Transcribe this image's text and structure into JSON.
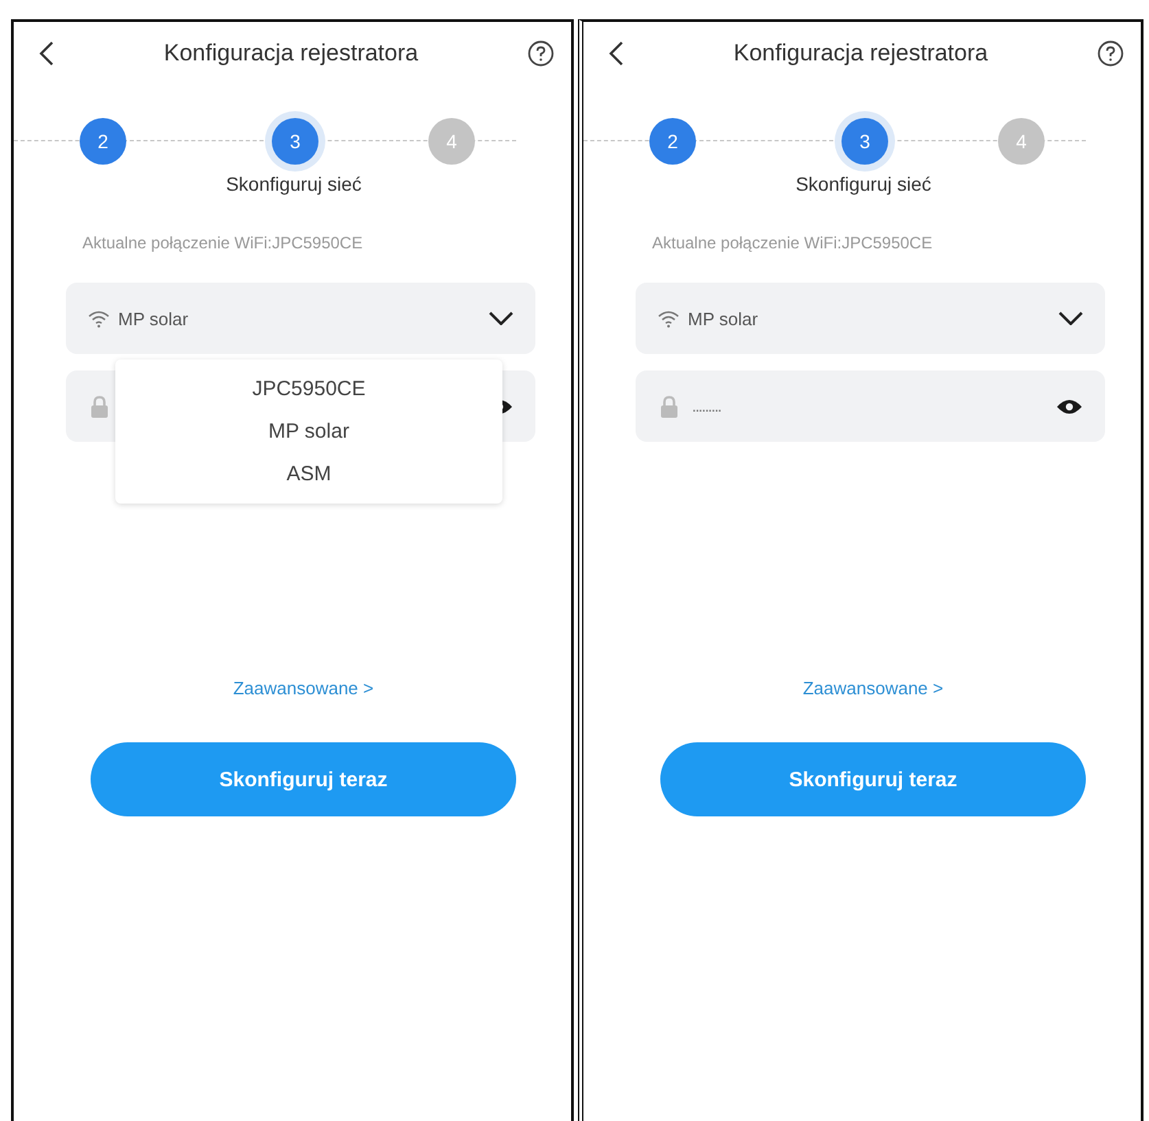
{
  "screens": [
    {
      "title": "Konfiguracja rejestratora",
      "steps": [
        {
          "label": "2",
          "completed": true,
          "selected": false
        },
        {
          "label": "3",
          "completed": false,
          "selected": true
        },
        {
          "label": "4",
          "completed": false,
          "selected": false
        }
      ],
      "step_caption": "Skonfiguruj sieć",
      "current_wifi": "Aktualne połączenie WiFi:JPC5950CE",
      "network_select": {
        "value": "MP solar",
        "options": [
          "JPC5950CE",
          "MP solar",
          "ASM"
        ]
      },
      "advanced_link": "Zaawansowane >",
      "submit_button": "Skonfiguruj teraz"
    },
    {
      "title": "Konfiguracja rejestratora",
      "steps": [
        {
          "label": "2",
          "completed": true,
          "selected": false
        },
        {
          "label": "3",
          "completed": false,
          "selected": true
        },
        {
          "label": "4",
          "completed": false,
          "selected": false
        }
      ],
      "step_caption": "Skonfiguruj sieć",
      "current_wifi": "Aktualne połączenie WiFi:JPC5950CE",
      "network_select": {
        "value": "MP solar"
      },
      "password": {
        "value": "........."
      },
      "advanced_link": "Zaawansowane >",
      "submit_button": "Skonfiguruj teraz"
    }
  ]
}
